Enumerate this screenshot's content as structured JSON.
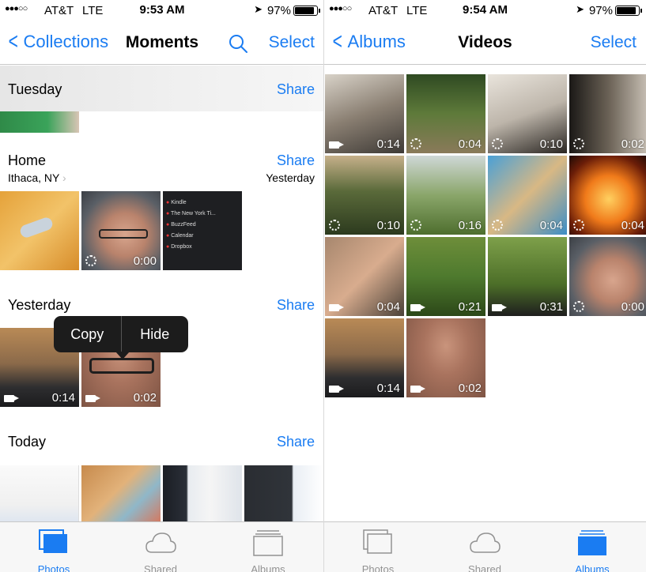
{
  "colors": {
    "accent": "#1a7cf2",
    "tab_inactive": "#929292",
    "popup_bg": "#1c1c1c"
  },
  "left": {
    "status": {
      "signal": "●●●○○",
      "carrier": "AT&T",
      "network": "LTE",
      "time": "9:53 AM",
      "battery": "97%"
    },
    "nav": {
      "back_label": "Collections",
      "title": "Moments",
      "select_label": "Select"
    },
    "moments": [
      {
        "name": "Tuesday",
        "share": "Share"
      },
      {
        "name": "Home",
        "location": "Ithaca, NY",
        "date": "Yesterday",
        "share": "Share",
        "durations": [
          "",
          "0:00",
          ""
        ]
      },
      {
        "name": "Yesterday",
        "share": "Share",
        "durations": [
          "0:14",
          "0:02"
        ]
      },
      {
        "name": "Today",
        "share": "Share"
      }
    ],
    "popup": {
      "copy": "Copy",
      "hide": "Hide"
    },
    "list_items": [
      "Kindle",
      "The New York Ti...",
      "BuzzFeed",
      "Calendar",
      "Dropbox"
    ],
    "tabs": [
      "Photos",
      "Shared",
      "Albums"
    ],
    "active_tab": "Photos"
  },
  "right": {
    "status": {
      "signal": "●●●○○",
      "carrier": "AT&T",
      "network": "LTE",
      "time": "9:54 AM",
      "battery": "97%"
    },
    "nav": {
      "back_label": "Albums",
      "title": "Videos",
      "select_label": "Select"
    },
    "videos": [
      {
        "duration": "0:14",
        "icon": "camera"
      },
      {
        "duration": "0:04",
        "icon": "spinner"
      },
      {
        "duration": "0:10",
        "icon": "spinner"
      },
      {
        "duration": "0:02",
        "icon": "spinner"
      },
      {
        "duration": "0:10",
        "icon": "spinner"
      },
      {
        "duration": "0:16",
        "icon": "spinner"
      },
      {
        "duration": "0:04",
        "icon": "spinner"
      },
      {
        "duration": "0:04",
        "icon": "spinner"
      },
      {
        "duration": "0:04",
        "icon": "camera"
      },
      {
        "duration": "0:21",
        "icon": "camera"
      },
      {
        "duration": "0:31",
        "icon": "camera"
      },
      {
        "duration": "0:00",
        "icon": "spinner"
      },
      {
        "duration": "0:14",
        "icon": "camera"
      },
      {
        "duration": "0:02",
        "icon": "camera"
      }
    ],
    "tabs": [
      "Photos",
      "Shared",
      "Albums"
    ],
    "active_tab": "Albums"
  }
}
